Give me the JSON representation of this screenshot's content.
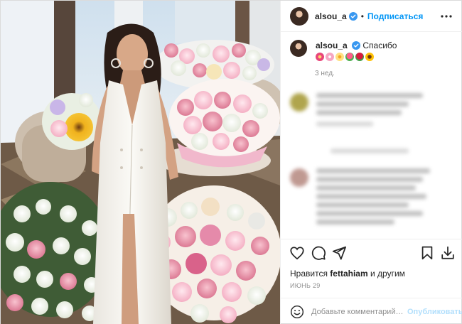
{
  "post": {
    "username": "alsou_a",
    "verified": true,
    "follow_label": "Подписаться",
    "separator": "•"
  },
  "caption": {
    "username": "alsou_a",
    "text": "Спасибо",
    "emojis": [
      "hibiscus",
      "cherry-blossom",
      "blossom",
      "tulip",
      "rose",
      "sunflower"
    ],
    "time_ago": "3 нед."
  },
  "likes": {
    "prefix": "Нравится",
    "user": "fettahiam",
    "suffix": "и другим"
  },
  "date": "ИЮНЬ 29",
  "comment": {
    "placeholder": "Добавьте комментарий…",
    "post_label": "Опубликовать"
  },
  "icons": {
    "more": "more-horizontal-icon",
    "like": "heart-icon",
    "comment": "comment-icon",
    "share": "share-plane-icon",
    "save": "bookmark-icon",
    "download": "download-icon",
    "emoji": "smile-icon"
  },
  "colors": {
    "link": "#0095f6",
    "post_button_disabled": "#b2dffc",
    "secondary_text": "#8e8e8e"
  }
}
